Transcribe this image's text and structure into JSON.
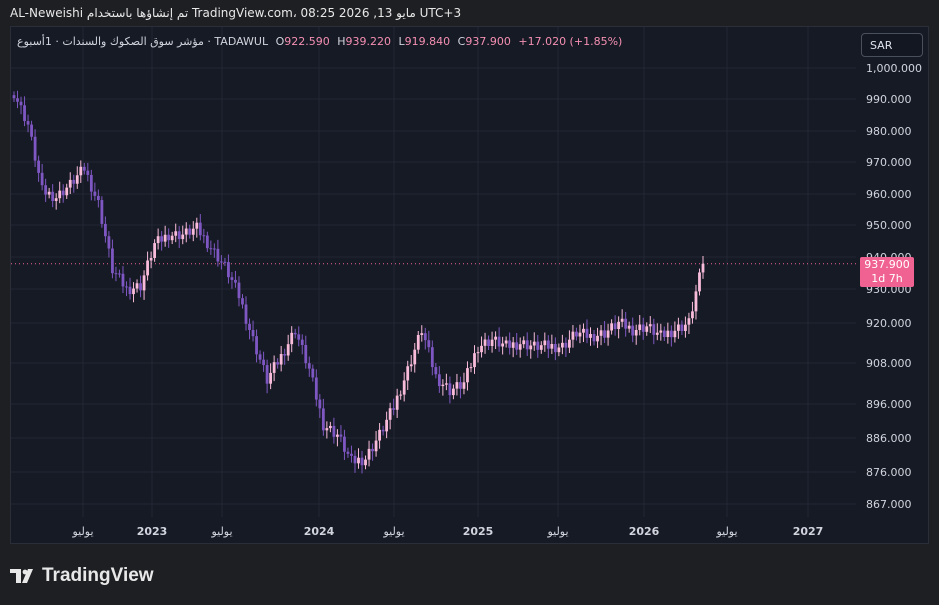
{
  "header": {
    "caption": "AL-Neweishi تم إنشاؤها باستخدام TradingView.com، 08:25 2026 ,13 مايو UTC+3"
  },
  "legend": {
    "symbol": "مؤشر سوق الصكوك والسندات · 1أسبوع · TADAWUL",
    "open_label": "O",
    "open": "922.590",
    "high_label": "H",
    "high": "939.220",
    "low_label": "L",
    "low": "919.840",
    "close_label": "C",
    "close": "937.900",
    "change": "+17.020 (+1.85%)"
  },
  "currency": {
    "label": "SAR"
  },
  "price_badge": {
    "price": "937.900",
    "countdown": "1d 7h"
  },
  "brand": {
    "logo_icon": "tradingview-logo-icon",
    "name": "TradingView"
  },
  "colors": {
    "up": "#f8bbd9",
    "down": "#7e57c2",
    "last_price": "#f06292",
    "background": "#161a25"
  },
  "chart_data": {
    "type": "candlestick",
    "timeframe": "1W",
    "y_ticks": [
      "1,000.000",
      "990.000",
      "980.000",
      "970.000",
      "960.000",
      "950.000",
      "940.000",
      "930.000",
      "920.000",
      "908.000",
      "896.000",
      "886.000",
      "876.000",
      "867.000"
    ],
    "x_ticks": [
      "يوليو",
      "2023",
      "يوليو",
      "2024",
      "يوليو",
      "2025",
      "يوليو",
      "2026",
      "يوليو",
      "2027"
    ],
    "last_price": 937.9,
    "grid": true,
    "series": [
      {
        "date": "2022-04",
        "close": 992
      },
      {
        "date": "2022-05",
        "close": 982
      },
      {
        "date": "2022-06",
        "close": 961
      },
      {
        "date": "2022-07",
        "close": 959
      },
      {
        "date": "2022-08",
        "close": 963
      },
      {
        "date": "2022-09",
        "close": 968
      },
      {
        "date": "2022-10",
        "close": 957
      },
      {
        "date": "2022-11",
        "close": 936
      },
      {
        "date": "2022-12",
        "close": 930
      },
      {
        "date": "2023-01",
        "close": 931
      },
      {
        "date": "2023-02",
        "close": 944
      },
      {
        "date": "2023-03",
        "close": 947
      },
      {
        "date": "2023-04",
        "close": 947
      },
      {
        "date": "2023-05",
        "close": 949
      },
      {
        "date": "2023-06",
        "close": 943
      },
      {
        "date": "2023-07",
        "close": 937
      },
      {
        "date": "2023-08",
        "close": 928
      },
      {
        "date": "2023-09",
        "close": 915
      },
      {
        "date": "2023-10",
        "close": 903
      },
      {
        "date": "2023-11",
        "close": 910
      },
      {
        "date": "2023-12",
        "close": 918
      },
      {
        "date": "2024-01",
        "close": 906
      },
      {
        "date": "2024-02",
        "close": 890
      },
      {
        "date": "2024-03",
        "close": 887
      },
      {
        "date": "2024-04",
        "close": 879
      },
      {
        "date": "2024-05",
        "close": 880
      },
      {
        "date": "2024-06",
        "close": 887
      },
      {
        "date": "2024-07",
        "close": 895
      },
      {
        "date": "2024-08",
        "close": 906
      },
      {
        "date": "2024-09",
        "close": 918
      },
      {
        "date": "2024-10",
        "close": 904
      },
      {
        "date": "2024-11",
        "close": 900
      },
      {
        "date": "2024-12",
        "close": 902
      },
      {
        "date": "2025-01",
        "close": 913
      },
      {
        "date": "2025-02",
        "close": 915
      },
      {
        "date": "2025-03",
        "close": 913
      },
      {
        "date": "2025-04",
        "close": 914
      },
      {
        "date": "2025-05",
        "close": 913
      },
      {
        "date": "2025-06",
        "close": 913
      },
      {
        "date": "2025-07",
        "close": 913
      },
      {
        "date": "2025-08",
        "close": 917
      },
      {
        "date": "2025-09",
        "close": 916
      },
      {
        "date": "2025-10",
        "close": 917
      },
      {
        "date": "2025-11",
        "close": 920
      },
      {
        "date": "2025-12",
        "close": 918
      },
      {
        "date": "2026-01",
        "close": 919
      },
      {
        "date": "2026-02",
        "close": 916
      },
      {
        "date": "2026-03",
        "close": 918
      },
      {
        "date": "2026-04",
        "close": 920
      },
      {
        "date": "2026-05",
        "close": 937.9
      }
    ]
  }
}
